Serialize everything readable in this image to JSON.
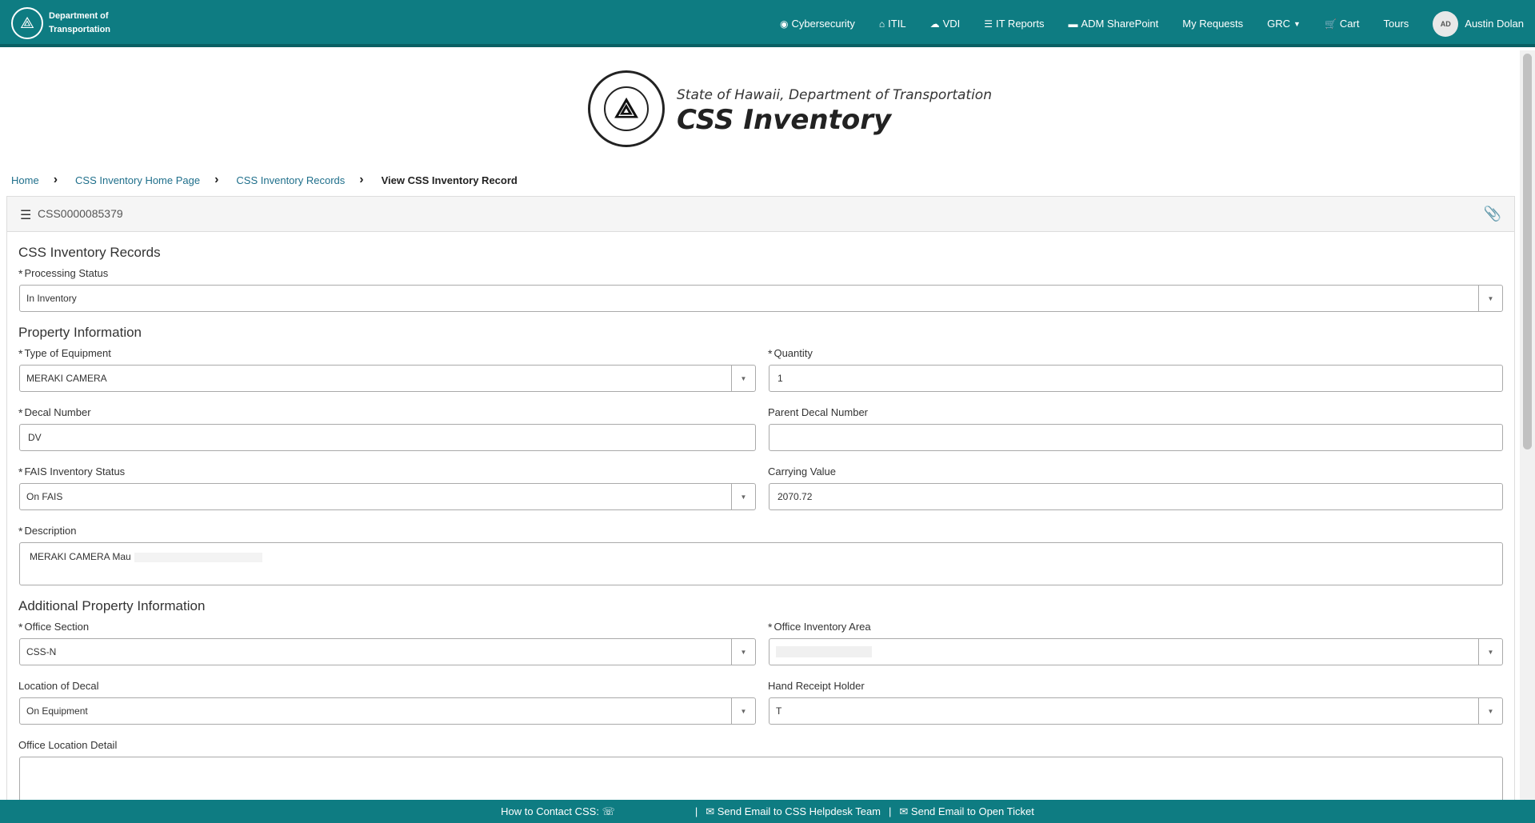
{
  "nav": {
    "brand_line1": "Department of",
    "brand_line2": "Transportation",
    "links": [
      {
        "label": "Cybersecurity",
        "icon": "eye-slash-icon"
      },
      {
        "label": "ITIL",
        "icon": "home-icon"
      },
      {
        "label": "VDI",
        "icon": "cloud-icon"
      },
      {
        "label": "IT Reports",
        "icon": "list-icon"
      },
      {
        "label": "ADM SharePoint",
        "icon": "folder-icon"
      },
      {
        "label": "My Requests",
        "icon": ""
      },
      {
        "label": "GRC",
        "icon": "caret-down-icon"
      },
      {
        "label": "Cart",
        "icon": "cart-icon"
      },
      {
        "label": "Tours",
        "icon": ""
      }
    ],
    "user_initials": "AD",
    "user_name": "Austin Dolan"
  },
  "header": {
    "subtitle": "State of Hawaii, Department of Transportation",
    "title": "CSS Inventory"
  },
  "breadcrumb": [
    "Home",
    "CSS Inventory Home Page",
    "CSS Inventory Records",
    "View CSS Inventory Record"
  ],
  "record": {
    "number": "CSS0000085379"
  },
  "form": {
    "section1_title": "CSS Inventory Records",
    "processing_status_label": "Processing Status",
    "processing_status_value": "In Inventory",
    "section2_title": "Property Information",
    "type_of_equipment_label": "Type of Equipment",
    "type_of_equipment_value": "MERAKI CAMERA",
    "quantity_label": "Quantity",
    "quantity_value": "1",
    "decal_number_label": "Decal Number",
    "decal_number_value": "DV",
    "parent_decal_label": "Parent Decal Number",
    "parent_decal_value": "",
    "fais_status_label": "FAIS Inventory Status",
    "fais_status_value": "On FAIS",
    "carrying_value_label": "Carrying Value",
    "carrying_value_value": "2070.72",
    "description_label": "Description",
    "description_value": "MERAKI CAMERA Mau",
    "section3_title": "Additional Property Information",
    "office_section_label": "Office Section",
    "office_section_value": "CSS-N",
    "office_inventory_area_label": "Office Inventory Area",
    "office_inventory_area_value": "",
    "location_of_decal_label": "Location of Decal",
    "location_of_decal_value": "On Equipment",
    "hand_receipt_holder_label": "Hand Receipt Holder",
    "hand_receipt_holder_value": "T",
    "office_location_detail_label": "Office Location Detail",
    "office_location_detail_value": "",
    "required_marker": "*"
  },
  "footer": {
    "contact": "How to Contact CSS:",
    "email_helpdesk": "Send Email to CSS Helpdesk Team",
    "email_ticket": "Send Email to Open Ticket"
  },
  "colors": {
    "primary": "#0e7c82",
    "link": "#1f6f8b"
  }
}
